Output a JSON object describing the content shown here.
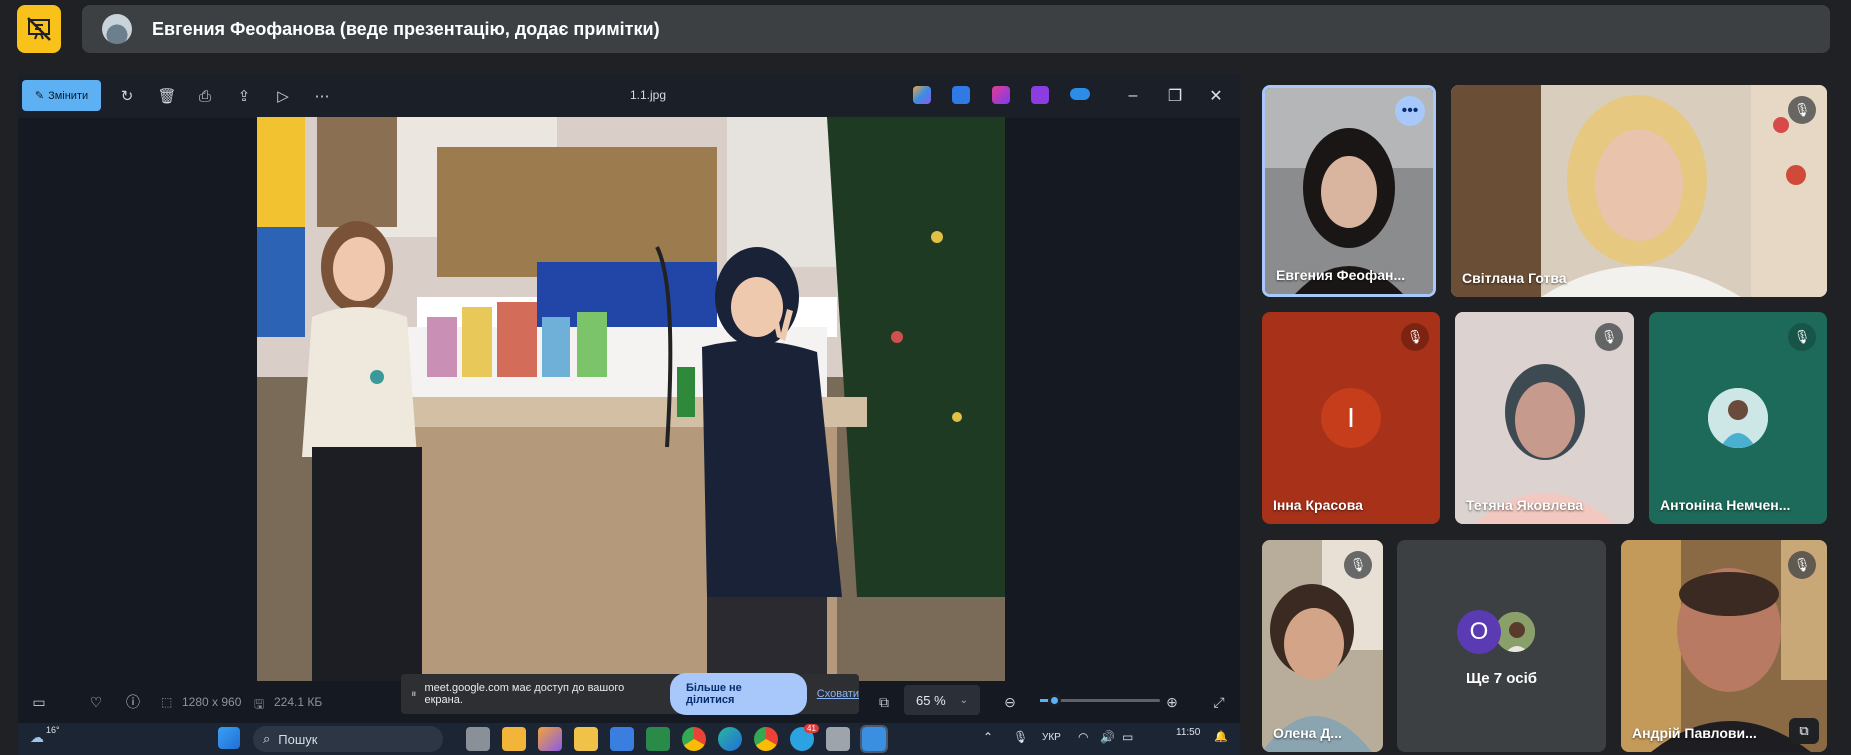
{
  "meet": {
    "presenter_banner": "Евгения Феофанова (веде презентацію, додає примітки)"
  },
  "photos_app": {
    "edit_label": "Змінити",
    "file_name": "1.1.jpg",
    "dimensions": "1280 x 960",
    "file_size": "224.1 КБ",
    "zoom_value": "65 %",
    "zoom_fraction": 0.05
  },
  "share_banner": {
    "text": "meet.google.com має доступ до вашого екрана.",
    "stop_label": "Більше не ділитися",
    "hide_label": "Сховати"
  },
  "taskbar": {
    "weather": "16°",
    "search_placeholder": "Пошук",
    "language": "УКР",
    "time": "11:50",
    "telegram_badge": "41"
  },
  "participants": [
    {
      "name": "Евгения Феофан...",
      "muted": false,
      "speaking": true
    },
    {
      "name": "Світлана Готва",
      "muted": true
    },
    {
      "name": "Інна Красова",
      "muted": true,
      "initial": "І",
      "color": "#c53d1a"
    },
    {
      "name": "Тетяна Яковлева",
      "muted": true
    },
    {
      "name": "Антоніна Немчен...",
      "muted": true
    },
    {
      "name": "Олена Д...",
      "muted": true
    },
    {
      "name": "Андрій Павлови...",
      "muted": true
    }
  ],
  "others": {
    "label": "Ще 7 осіб",
    "initial": "О",
    "initial_color": "#5b3bb3"
  },
  "colors": {
    "pin_yellow": "#f9c21a",
    "accent_blue": "#5db1f2",
    "stop_share_bg": "#a8c7fa"
  }
}
